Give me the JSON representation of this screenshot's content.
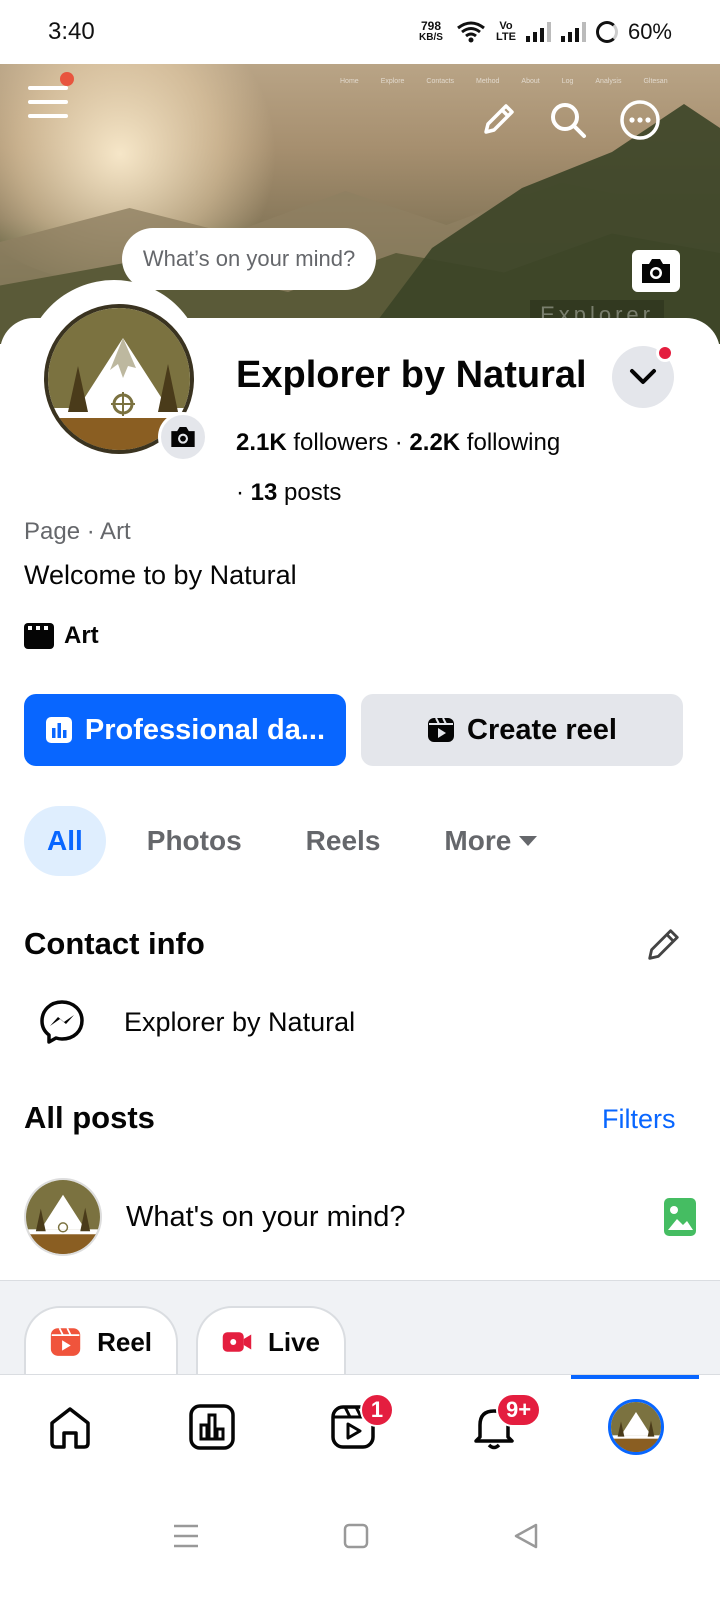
{
  "status_bar": {
    "time": "3:40",
    "net_speed": "798",
    "net_unit": "KB/S",
    "volte": "Vo\nLTE",
    "battery": "60%"
  },
  "cover": {
    "nav_links": [
      "Home",
      "Explore",
      "Contacts",
      "Method",
      "About",
      "Log",
      "Analysis",
      "Gltesan"
    ],
    "watermark": "Explorer",
    "mind_bubble": "What’s on your mind?"
  },
  "profile": {
    "name": "Explorer by Natural",
    "followers_count": "2.1K",
    "followers_label": "followers",
    "following_count": "2.2K",
    "following_label": "following",
    "posts_count": "13",
    "posts_label": "posts",
    "meta": "Page · Art",
    "bio": "Welcome to  by Natural",
    "category": "Art"
  },
  "actions": {
    "professional": "Professional da...",
    "create_reel": "Create reel"
  },
  "tabs": [
    {
      "label": "All",
      "active": true
    },
    {
      "label": "Photos",
      "active": false
    },
    {
      "label": "Reels",
      "active": false
    },
    {
      "label": "More",
      "active": false
    }
  ],
  "contact": {
    "title": "Contact info",
    "messenger_name": "Explorer by Natural"
  },
  "posts": {
    "title": "All posts",
    "filters": "Filters",
    "composer_placeholder": "What's on your mind?",
    "chip_reel": "Reel",
    "chip_live": "Live"
  },
  "bottom_nav": {
    "reels_badge": "1",
    "notifications_badge": "9+"
  },
  "colors": {
    "brand_blue": "#0866ff",
    "badge_red": "#e41e3f",
    "photo_green": "#45bd62"
  }
}
